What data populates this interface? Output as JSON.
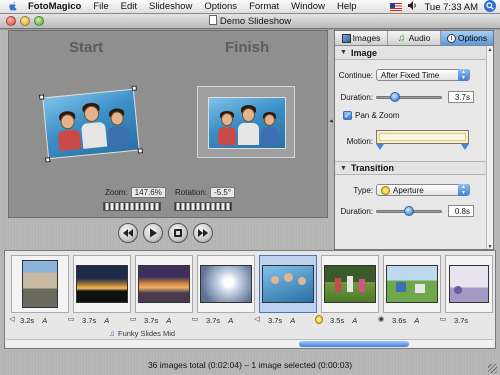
{
  "menubar": {
    "app_name": "FotoMagico",
    "items": [
      "File",
      "Edit",
      "Slideshow",
      "Options",
      "Format",
      "Window",
      "Help"
    ],
    "clock": "Tue 7:33 AM"
  },
  "window": {
    "title": "Demo Slideshow"
  },
  "preview": {
    "start_heading": "Start",
    "finish_heading": "Finish",
    "zoom_label": "Zoom:",
    "zoom_value": "147.6%",
    "rotation_label": "Rotation:",
    "rotation_value": "-5.5°"
  },
  "inspector": {
    "tabs": [
      {
        "label": "Images",
        "icon": "images-icon",
        "active": false
      },
      {
        "label": "Audio",
        "icon": "audio-icon",
        "active": false
      },
      {
        "label": "Options",
        "icon": "options-icon",
        "active": true
      }
    ],
    "image_section": {
      "title": "Image",
      "continue_label": "Continue:",
      "continue_value": "After Fixed Time",
      "duration_label": "Duration:",
      "duration_value": "3.7s",
      "duration_slider_level": 0.25,
      "pan_zoom_label": "Pan & Zoom",
      "pan_zoom_checked": true,
      "motion_label": "Motion:"
    },
    "transition_section": {
      "title": "Transition",
      "type_label": "Type:",
      "type_value": "Aperture",
      "duration_label": "Duration:",
      "duration_value": "0.8s",
      "duration_slider_level": 0.5
    }
  },
  "timeline": {
    "slides": [
      {
        "duration": "3.2s",
        "auto": "A",
        "selected": false
      },
      {
        "duration": "3.7s",
        "auto": "A",
        "selected": false
      },
      {
        "duration": "3.7s",
        "auto": "A",
        "selected": false
      },
      {
        "duration": "3.7s",
        "auto": "A",
        "selected": false
      },
      {
        "duration": "3.7s",
        "auto": "A",
        "selected": true
      },
      {
        "duration": "3.5s",
        "auto": "A",
        "selected": false
      },
      {
        "duration": "3.6s",
        "auto": "A",
        "selected": false
      },
      {
        "duration": "3.7s",
        "auto": "",
        "selected": false
      }
    ],
    "audio_track": "Funky Slides Mid"
  },
  "status": {
    "text": "36 images total (0:02:04)  –  1 image selected (0:00:03)"
  },
  "colors": {
    "accent": "#3b7fd6",
    "tab_active": "#5c98da",
    "selection": "#bcd2f0"
  }
}
